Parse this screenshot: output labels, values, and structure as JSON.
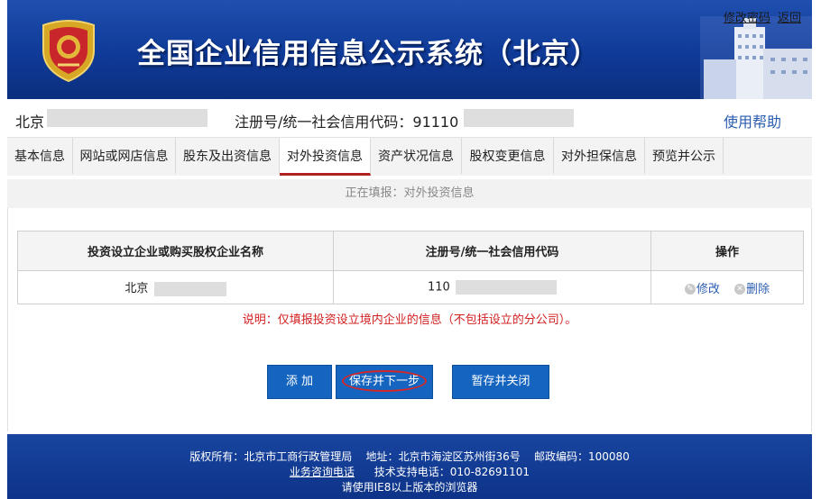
{
  "header": {
    "title": "全国企业信用信息公示系统（北京）",
    "links": {
      "change_password": "修改密码",
      "back": "返回"
    },
    "emblem_icon": "police-emblem-icon"
  },
  "info": {
    "city": "北京",
    "reg_label": "注册号/统一社会信用代码：91110",
    "help": "使用帮助"
  },
  "tabs": [
    "基本信息",
    "网站或网店信息",
    "股东及出资信息",
    "对外投资信息",
    "资产状况信息",
    "股权变更信息",
    "对外担保信息",
    "预览并公示"
  ],
  "active_tab": "对外投资信息",
  "status": "正在填报：对外投资信息",
  "table": {
    "headers": [
      "投资设立企业或购买股权企业名称",
      "注册号/统一社会信用代码",
      "操作"
    ],
    "rows": [
      {
        "name": "北京",
        "code": "110",
        "edit": "修改",
        "delete": "删除"
      }
    ]
  },
  "note": "说明：仅填报投资设立境内企业的信息（不包括设立的分公司）。",
  "buttons": {
    "add": "添 加",
    "save_next": "保存并下一步",
    "save_close": "暂存并关闭"
  },
  "footer": {
    "line1": "版权所有：北京市工商行政管理局    地址：北京市海淀区苏州街36号    邮政编码：100080",
    "consult": "业务咨询电话",
    "support": "技术支持电话：010-82691101",
    "line3": "请使用IE8以上版本的浏览器"
  },
  "colors": {
    "header_blue": "#0f3a97",
    "button_blue": "#1565c0",
    "note_red": "#d22020",
    "active_tab_border": "#b32020"
  }
}
